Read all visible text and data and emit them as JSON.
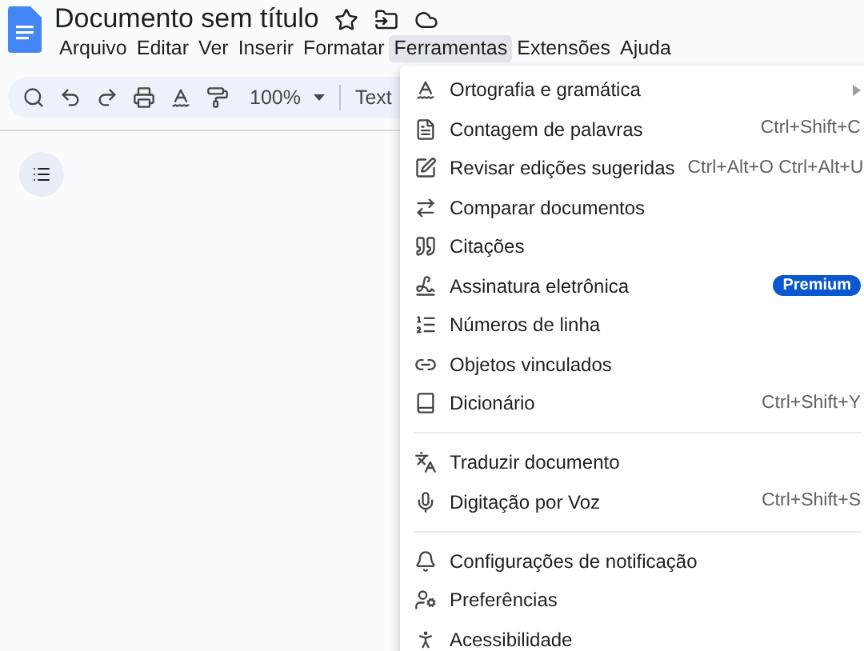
{
  "document": {
    "title": "Documento sem título"
  },
  "menu_bar": [
    {
      "label": "Arquivo",
      "selected": false
    },
    {
      "label": "Editar",
      "selected": false
    },
    {
      "label": "Ver",
      "selected": false
    },
    {
      "label": "Inserir",
      "selected": false
    },
    {
      "label": "Formatar",
      "selected": false
    },
    {
      "label": "Ferramentas",
      "selected": true
    },
    {
      "label": "Extensões",
      "selected": false
    },
    {
      "label": "Ajuda",
      "selected": false
    }
  ],
  "toolbar": {
    "zoom": "100%",
    "style": "Text"
  },
  "tools_menu": {
    "items": [
      {
        "kind": "item",
        "label": "Ortografia e gramática",
        "submenu": true
      },
      {
        "kind": "item",
        "label": "Contagem de palavras",
        "shortcut": "Ctrl+Shift+C",
        "submenu": false
      },
      {
        "kind": "item",
        "label": "Revisar edições sugeridas",
        "shortcut": "Ctrl+Alt+O Ctrl+Alt+U",
        "submenu": false
      },
      {
        "kind": "item",
        "label": "Comparar documentos",
        "submenu": false
      },
      {
        "kind": "item",
        "label": "Citações",
        "submenu": false
      },
      {
        "kind": "item",
        "label": "Assinatura eletrônica",
        "badge": "Premium",
        "submenu": false
      },
      {
        "kind": "item",
        "label": "Números de linha",
        "submenu": false
      },
      {
        "kind": "item",
        "label": "Objetos vinculados",
        "submenu": false
      },
      {
        "kind": "item",
        "label": "Dicionário",
        "shortcut": "Ctrl+Shift+Y",
        "submenu": false
      },
      {
        "kind": "separator"
      },
      {
        "kind": "item",
        "label": "Traduzir documento",
        "submenu": false
      },
      {
        "kind": "item",
        "label": "Digitação por Voz",
        "shortcut": "Ctrl+Shift+S",
        "submenu": false
      },
      {
        "kind": "separator"
      },
      {
        "kind": "item",
        "label": "Configurações de notificação",
        "submenu": false
      },
      {
        "kind": "item",
        "label": "Preferências",
        "submenu": false
      },
      {
        "kind": "item",
        "label": "Acessibilidade",
        "submenu": false
      }
    ]
  }
}
